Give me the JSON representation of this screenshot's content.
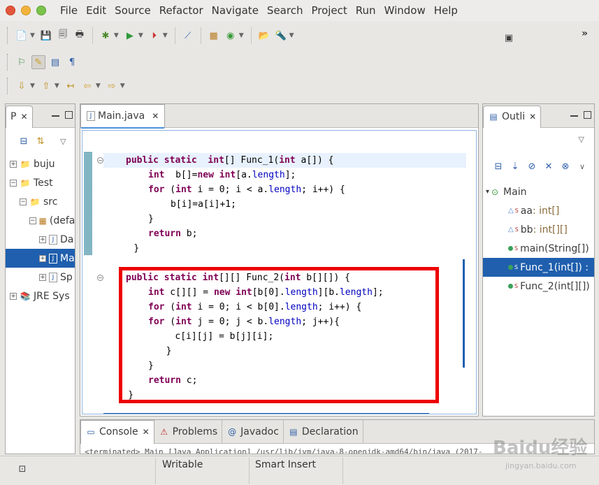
{
  "window": {
    "menu": [
      "File",
      "Edit",
      "Source",
      "Refactor",
      "Navigate",
      "Search",
      "Project",
      "Run",
      "Window",
      "Help"
    ]
  },
  "package_explorer": {
    "title": "P",
    "tree": [
      {
        "label": "buju",
        "indent": 0,
        "icon": "project-icon",
        "expander": "+"
      },
      {
        "label": "Test",
        "indent": 0,
        "icon": "project-icon",
        "expander": "−"
      },
      {
        "label": "src",
        "indent": 1,
        "icon": "source-folder-icon",
        "expander": "−"
      },
      {
        "label": "(defa",
        "indent": 2,
        "icon": "package-icon",
        "expander": "−"
      },
      {
        "label": "Da",
        "indent": 3,
        "icon": "java-file-icon",
        "expander": "+"
      },
      {
        "label": "Ma",
        "indent": 3,
        "icon": "java-file-icon",
        "expander": "+",
        "selected": true
      },
      {
        "label": "Sp",
        "indent": 3,
        "icon": "java-file-icon",
        "expander": "+"
      },
      {
        "label": "JRE Sys",
        "indent": 0,
        "icon": "library-icon",
        "expander": "+"
      }
    ]
  },
  "editor": {
    "tab_label": "Main.java",
    "lines": [
      {
        "html": "<span class=\"kw\">public</span> <span class=\"kw\">static</span>  <span class=\"kw\">int</span>[] Func_1(<span class=\"kw\">int</span> a[]) {",
        "indent": 1,
        "current": true
      },
      {
        "html": "<span class=\"kw\">int</span>  b[]=<span class=\"kw\">new</span> <span class=\"kw\">int</span>[a.<span class=\"fld\">length</span>];",
        "indent": 2
      },
      {
        "html": "<span class=\"kw\">for</span> (<span class=\"kw\">int</span> i = 0; i &lt; a.<span class=\"fld\">length</span>; i++) {",
        "indent": 2
      },
      {
        "html": "b[i]=a[i]+1;",
        "indent": 3
      },
      {
        "html": "}",
        "indent": 2
      },
      {
        "html": "<span class=\"kw\">return</span> b;",
        "indent": 2
      },
      {
        "html": "}",
        "indent": 1.35
      },
      {
        "html": "",
        "indent": 0
      },
      {
        "html": "<span class=\"kw\">public</span> <span class=\"kw\">static</span> <span class=\"kw\">int</span>[][] Func_2(<span class=\"kw\">int</span> b[][]) {",
        "indent": 1
      },
      {
        "html": "<span class=\"kw\">int</span> c[][] = <span class=\"kw\">new</span> <span class=\"kw\">int</span>[b[0].<span class=\"fld\">length</span>][b.<span class=\"fld\">length</span>];",
        "indent": 2
      },
      {
        "html": "<span class=\"kw\">for</span> (<span class=\"kw\">int</span> i = 0; i &lt; b[0].<span class=\"fld\">length</span>; i++) {",
        "indent": 2
      },
      {
        "html": "<span class=\"kw\">for</span> (<span class=\"kw\">int</span> j = 0; j &lt; b.<span class=\"fld\">length</span>; j++){",
        "indent": 2
      },
      {
        "html": "c[i][j] = b[j][i];",
        "indent": 3.2
      },
      {
        "html": "}",
        "indent": 2.8
      },
      {
        "html": "}",
        "indent": 2
      },
      {
        "html": "<span class=\"kw\">return</span> c;",
        "indent": 2
      },
      {
        "html": "}",
        "indent": 1.1
      }
    ],
    "code_text": [
      "public static  int[] Func_1(int a[]) {",
      "int  b[]=new int[a.length];",
      "for (int i = 0; i < a.length; i++) {",
      "b[i]=a[i]+1;",
      "}",
      "return b;",
      "}",
      "",
      "public static int[][] Func_2(int b[][]) {",
      "int c[][] = new int[b[0].length][b.length];",
      "for (int i = 0; i < b[0].length; i++) {",
      "for (int j = 0; j < b.length; j++){",
      "c[i][j] = b[j][i];",
      "}",
      "}",
      "return c;",
      "}"
    ]
  },
  "outline": {
    "title": "Outli",
    "items": [
      {
        "name": "Main",
        "kind": "class",
        "indent": 0
      },
      {
        "name": "aa",
        "type": ": int[]",
        "kind": "field",
        "indent": 1
      },
      {
        "name": "bb",
        "type": ": int[][]",
        "kind": "field",
        "indent": 1
      },
      {
        "name": "main(String[])",
        "type": "",
        "kind": "method",
        "indent": 1
      },
      {
        "name": "Func_1(int[]) :",
        "type": "",
        "kind": "method",
        "indent": 1,
        "selected": true
      },
      {
        "name": "Func_2(int[][])",
        "type": "",
        "kind": "method",
        "indent": 1
      }
    ]
  },
  "bottom_panel": {
    "tabs": [
      "Console",
      "Problems",
      "Javadoc",
      "Declaration"
    ],
    "console_text": "<terminated> Main [Java Application] /usr/lib/jvm/java-8-openjdk-amd64/bin/java (2017-"
  },
  "status": {
    "writable": "Writable",
    "insert_mode": "Smart Insert"
  },
  "watermark": {
    "main": "Baidu经验",
    "sub": "jingyan.baidu.com"
  },
  "colors": {
    "selection": "#1f5fae",
    "keyword": "#7f0055",
    "field": "#0000c0",
    "highlight_box": "#ee0000"
  }
}
